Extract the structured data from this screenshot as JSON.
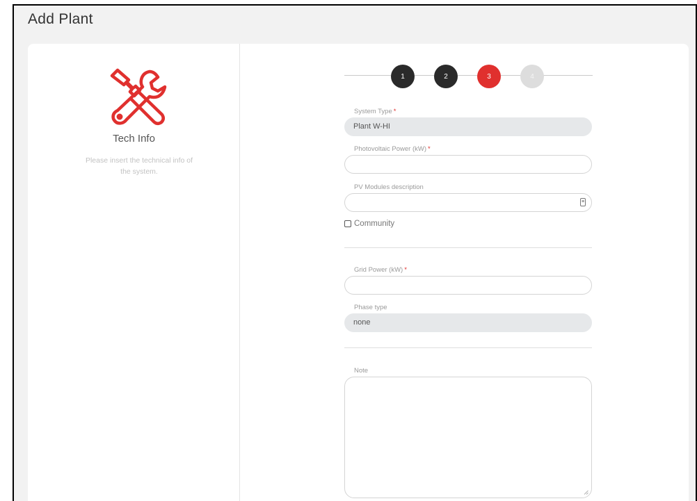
{
  "page": {
    "title": "Add Plant"
  },
  "sidebar": {
    "icon": "tools-icon",
    "title": "Tech Info",
    "description": "Please insert the technical info of the system."
  },
  "stepper": {
    "steps": [
      {
        "label": "1",
        "state": "done"
      },
      {
        "label": "2",
        "state": "done"
      },
      {
        "label": "3",
        "state": "active"
      },
      {
        "label": "4",
        "state": "pending"
      }
    ]
  },
  "form": {
    "system_type": {
      "label": "System Type",
      "required": "*",
      "value": "Plant W-HI"
    },
    "pv_power": {
      "label": "Photovoltaic Power (kW)",
      "required": "*",
      "value": ""
    },
    "pv_modules": {
      "label": "PV Modules description",
      "value": "",
      "icon": "text-field-icon"
    },
    "community": {
      "label": "Community",
      "checked": false
    },
    "grid_power": {
      "label": "Grid Power (kW)",
      "required": "*",
      "value": ""
    },
    "phase_type": {
      "label": "Phase type",
      "value": "none"
    },
    "note": {
      "label": "Note",
      "value": ""
    }
  },
  "colors": {
    "accent": "#e0302e",
    "step_done": "#2a2a2a",
    "step_pending": "#dddddd",
    "disabled_field": "#e6e8ea"
  }
}
